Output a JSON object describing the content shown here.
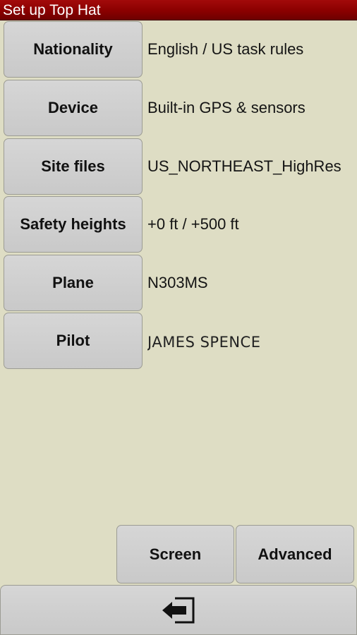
{
  "window": {
    "title": "Set up Top Hat"
  },
  "settings": [
    {
      "label": "Nationality",
      "value": "English / US task rules"
    },
    {
      "label": "Device",
      "value": "Built-in GPS & sensors"
    },
    {
      "label": "Site files",
      "value": "US_NORTHEAST_HighRes"
    },
    {
      "label": "Safety heights",
      "value": "+0 ft / +500 ft"
    },
    {
      "label": "Plane",
      "value": "N303MS"
    },
    {
      "label": "Pilot",
      "value": "JAMES SPENCE"
    }
  ],
  "bottom_buttons": {
    "screen_label": "Screen",
    "advanced_label": "Advanced"
  },
  "exit": {
    "icon": "exit-icon"
  },
  "colors": {
    "titlebar": "#8a0000",
    "background": "#deddc4",
    "button": "#cfcfcf"
  }
}
